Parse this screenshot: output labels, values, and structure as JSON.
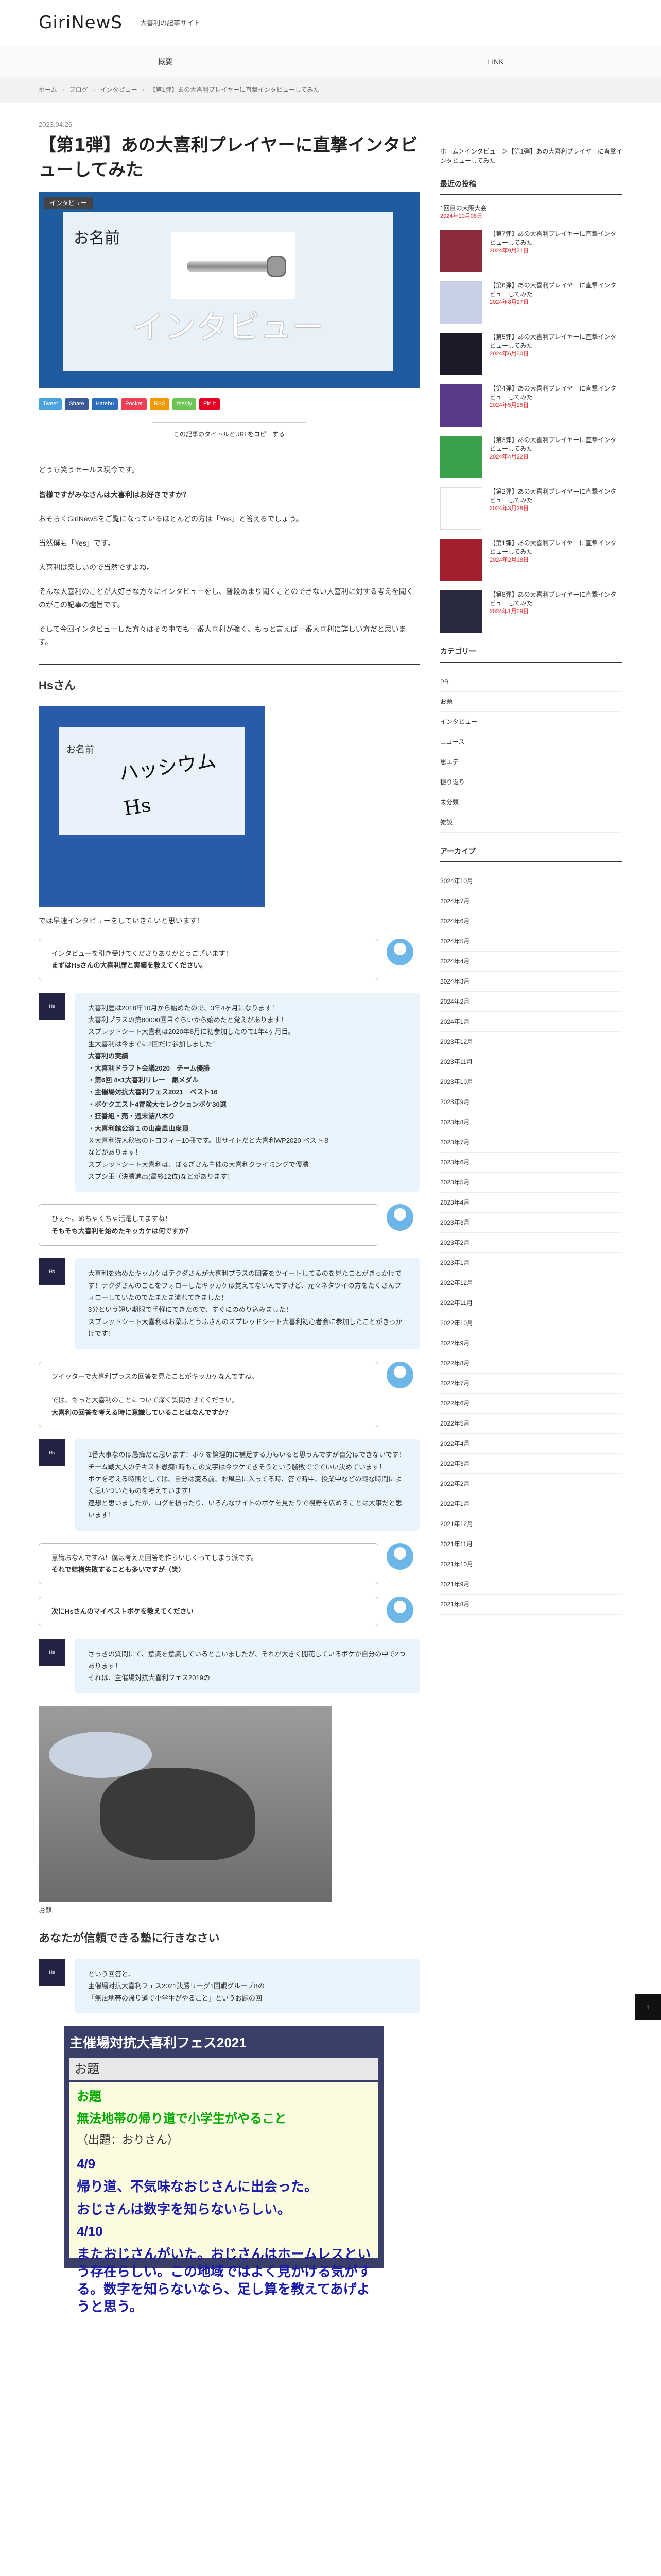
{
  "header": {
    "logo": "GiriNewS",
    "tagline": "大喜利の記事サイト"
  },
  "gnav": [
    "概要",
    "LINK"
  ],
  "breadcrumb": [
    "ホーム",
    "ブログ",
    "インタビュー",
    "【第1弾】あの大喜利プレイヤーに直撃インタビューしてみた"
  ],
  "article": {
    "date": "2023.04.26",
    "title": "【第1弾】あの大喜利プレイヤーに直撃インタビューしてみた",
    "category_tag": "インタビュー",
    "eyecatch_name": "お名前",
    "eyecatch_big": "インタビュー",
    "share": [
      {
        "label": "Tweet",
        "color": "#4aa3df"
      },
      {
        "label": "Share",
        "color": "#3b5998"
      },
      {
        "label": "Hatebu",
        "color": "#2c6ebd"
      },
      {
        "label": "Pocket",
        "color": "#ef3f56"
      },
      {
        "label": "RSS",
        "color": "#f39800"
      },
      {
        "label": "feedly",
        "color": "#6cc655"
      },
      {
        "label": "Pin it",
        "color": "#e60023"
      }
    ],
    "copy_button": "この記事のタイトルとURLをコピーする",
    "intro": [
      "どうも笑うセールス現今です。",
      "皆様ですがみなさんは大喜利はお好きですか？",
      "おそらくGiriNewSをご覧になっているほとんどの方は「Yes」と答えるでしょう。",
      "当然僕も「Yes」です。",
      "大喜利は楽しいので当然ですよね。",
      "そんな大喜利のことが大好きな方々にインタビューをし、普段あまり聞くことのできない大喜利に対する考えを聞くのがこの記事の趣旨です。",
      "そして今回インタビューした方々はその中でも一番大喜利が強く、もっと言えば一番大喜利に詳しい方だと思います。"
    ],
    "section_title": "Hsさん",
    "hs_card_name": "お名前",
    "hs_card_sig": "ハッシウム Hs",
    "hs_after": "では早速インタビューをしていきたいと思います！",
    "dialog": [
      {
        "side": "r",
        "lines": [
          "インタビューを引き受けてくださりありがとうございます！",
          "まずはHsさんの大喜利歴と実績を教えてください。"
        ]
      },
      {
        "side": "l",
        "lines": [
          "大喜利歴は2018年10月から始めたので、3年4ヶ月になります！",
          "大喜利プラスの第80000回目ぐらいから始めたと覚えがあります！",
          "スプレッドシート大喜利は2020年8月に初参加したので1年4ヶ月目。",
          "生大喜利は今までに2回だけ参加しました！",
          "大喜利の実績",
          "・大喜利ドラフト会議2020　チーム優勝",
          "・第6回 4×1大喜利リレー　銀メダル",
          "・主催場対抗大喜利フェス2021　ベスト16",
          "・ボケクエスト4冒険大セレクションボケ30選",
          "・狂番組・売・週末詰八木り",
          "・大喜利館公演１の山高風山度頂",
          "Ｘ大喜利洗人秘密のトロフィー10冊です。世サイトだと大喜利WP2020 ベスト８",
          "などがあります！",
          "スプレッドシート大喜利は、ぼるぎさん主催の大喜利クライミングで優勝",
          "スプシ王（決勝進出(最終12位)などがあります！"
        ]
      },
      {
        "side": "r",
        "lines": [
          "ひぇ〜、めちゃくちゃ活躍してますね！",
          "そもそも大喜利を始めたキッカケは何ですか？"
        ]
      },
      {
        "side": "l",
        "lines": [
          "大喜利を始めたキッカケはテクダさんが大喜利プラスの回答をツイートしてるのを見たことがきっかけです！テクダさんのことをフォローしたキッカケは覚えてないんですけど、元々ネタツイの方をたくさんフォローしていたのでたまたま流れてきました！",
          "3分という短い期限で手軽にできたので、すぐにのめり込みました！",
          "スプレッドシート大喜利はお菜ふとうふさんのスプレッドシート大喜利初心者会に参加したことがきっかけです！"
        ]
      },
      {
        "side": "r",
        "lines": [
          "ツイッターで大喜利プラスの回答を見たことがキッカケなんですね。",
          "",
          "では、もっと大喜利のことについて深く質問させてください。",
          "大喜利の回答を考える時に意識していることはなんですか？"
        ]
      },
      {
        "side": "l",
        "lines": [
          "1番大事なのは愚痴だと思います！ボケを論理的に補足する力もいると思うんですが自分はできないです！",
          "チーム戦大人のテキスト愚痴1時もこの文字は今ウケてきそうという勝敗ででていい決めています！",
          "ボケを考える時期としては、自分は変る前、お風呂に入ってる時、答で時中、授業中などの暇な時間によく思いついたものを考えています！",
          "連想と思いましたが、ログを振ったり、いろんなサイトのボケを見たりで視野を広めることは大事だと思います！"
        ]
      },
      {
        "side": "r",
        "lines": [
          "意識おなんですね！僕は考えた回答を作らいじくってしまう派です。",
          "それで結構失敗することも多いですが（笑）"
        ]
      },
      {
        "side": "r",
        "lines": [
          "次にHsさんのマイベストボケを教えてください"
        ]
      },
      {
        "side": "l",
        "lines": [
          "さっきの質問にて、意識を意識していると言いましたが、それが大きく開花しているボケが自分の中で2つあります！",
          "それは、主催場対抗大喜利フェス2019の"
        ]
      }
    ],
    "caption": "お題",
    "subheading": "あなたが信頼できる塾に行きなさい",
    "last_dialog": [
      "という回答と、",
      "主催場対抗大喜利フェス2021決勝リーグ1回戦グループBの",
      "「無法地帯の帰り道で小学生がやること」というお題の回"
    ],
    "quest": {
      "title": "主催場対抗大喜利フェス2021",
      "sub": "お題",
      "head": "お題",
      "theme": "無法地帯の帰り道で小学生がやること",
      "by": "（出題：おりさん）",
      "lines": [
        "4/9",
        "帰り道、不気味なおじさんに出会った。",
        "おじさんは数字を知らないらしい。",
        "4/10",
        "またおじさんがいた。おじさんはホームレスという存在らしい。この地域ではよく見かける気がする。数字を知らないなら、足し算を教えてあげようと思う。"
      ]
    }
  },
  "sidebar": {
    "top_note": "ホーム＞インタビュー＞【第1弾】あの大喜利プレイヤーに直撃インタビューしてみた",
    "recent_title": "最近の投稿",
    "recent_first": {
      "title": "1回目の大阪大会",
      "date": "2024年10月08日"
    },
    "recent": [
      {
        "title": "【第7弾】あの大喜利プレイヤーに直撃インタビューしてみた",
        "date": "2024年9月21日",
        "color": "#8b2c3c"
      },
      {
        "title": "【第6弾】あの大喜利プレイヤーに直撃インタビューしてみた",
        "date": "2024年8月27日",
        "color": "#c8d0e8"
      },
      {
        "title": "【第5弾】あの大喜利プレイヤーに直撃インタビューしてみた",
        "date": "2024年6月30日",
        "color": "#1a1a28"
      },
      {
        "title": "【第4弾】あの大喜利プレイヤーに直撃インタビューしてみた",
        "date": "2024年5月25日",
        "color": "#5a3a8a"
      },
      {
        "title": "【第3弾】あの大喜利プレイヤーに直撃インタビューしてみた",
        "date": "2024年4月22日",
        "color": "#3aa04a"
      },
      {
        "title": "【第2弾】あの大喜利プレイヤーに直撃インタビューしてみた",
        "date": "2024年3月28日",
        "color": "#ffffff"
      },
      {
        "title": "【第1弾】あの大喜利プレイヤーに直撃インタビューしてみた",
        "date": "2024年2月18日",
        "color": "#a02030"
      },
      {
        "title": "【第8弾】あの大喜利プレイヤーに直撃インタビューしてみた",
        "date": "2024年1月09日",
        "color": "#2a2a40"
      }
    ],
    "cat_title": "カテゴリー",
    "categories": [
      "PR",
      "お題",
      "インタビュー",
      "ニュース",
      "思エデ",
      "振り返り",
      "未分類",
      "雑談"
    ],
    "arc_title": "アーカイブ",
    "archives": [
      "2024年10月",
      "2024年7月",
      "2024年6月",
      "2024年5月",
      "2024年4月",
      "2024年3月",
      "2024年2月",
      "2024年1月",
      "2023年12月",
      "2023年11月",
      "2023年10月",
      "2023年9月",
      "2023年8月",
      "2023年7月",
      "2023年6月",
      "2023年5月",
      "2023年4月",
      "2023年3月",
      "2023年2月",
      "2023年1月",
      "2022年12月",
      "2022年11月",
      "2022年10月",
      "2022年9月",
      "2022年8月",
      "2022年7月",
      "2022年6月",
      "2022年5月",
      "2022年4月",
      "2022年3月",
      "2022年2月",
      "2022年1月",
      "2021年12月",
      "2021年11月",
      "2021年10月",
      "2021年9月",
      "2021年8月"
    ]
  }
}
